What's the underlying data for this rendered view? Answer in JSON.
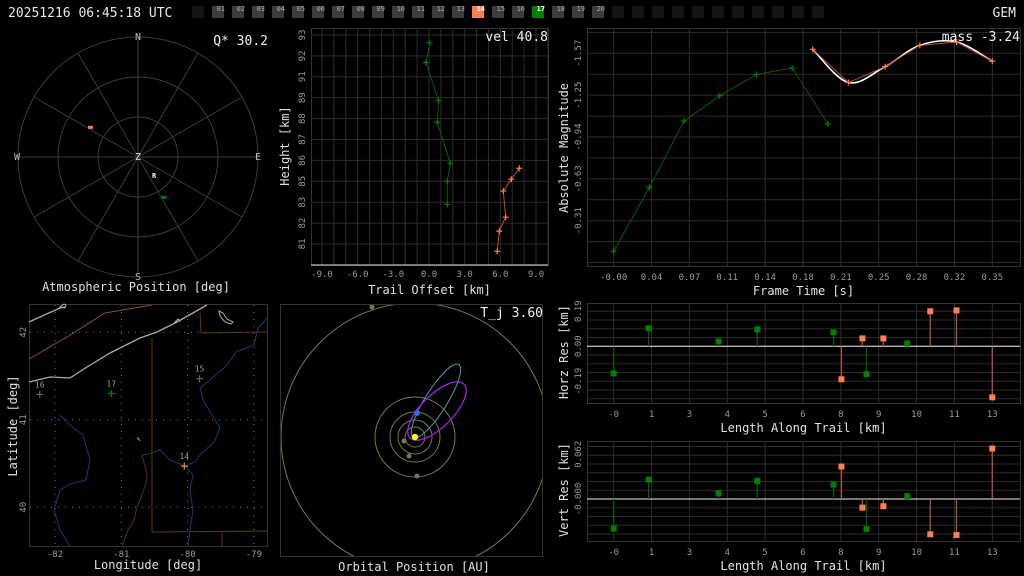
{
  "header": {
    "datetime": "20251216 06:45:18 UTC",
    "network": "GEM"
  },
  "colors": {
    "orange": "#ff7f50",
    "green": "#008000",
    "orange_line": "#b5532f",
    "green_line": "#0a5a0a",
    "inactive": "#3c3c3c",
    "empty": "#151515"
  },
  "camera_slots": [
    {
      "label": "01",
      "state": "inactive"
    },
    {
      "label": "02",
      "state": "inactive"
    },
    {
      "label": "03",
      "state": "inactive"
    },
    {
      "label": "04",
      "state": "inactive"
    },
    {
      "label": "05",
      "state": "inactive"
    },
    {
      "label": "06",
      "state": "inactive"
    },
    {
      "label": "07",
      "state": "inactive"
    },
    {
      "label": "08",
      "state": "inactive"
    },
    {
      "label": "09",
      "state": "inactive"
    },
    {
      "label": "10",
      "state": "inactive"
    },
    {
      "label": "11",
      "state": "inactive"
    },
    {
      "label": "12",
      "state": "inactive"
    },
    {
      "label": "13",
      "state": "inactive"
    },
    {
      "label": "14",
      "state": "orange"
    },
    {
      "label": "15",
      "state": "inactive"
    },
    {
      "label": "16",
      "state": "inactive"
    },
    {
      "label": "17",
      "state": "green"
    },
    {
      "label": "18",
      "state": "inactive"
    },
    {
      "label": "19",
      "state": "inactive"
    },
    {
      "label": "20",
      "state": "inactive"
    }
  ],
  "polar": {
    "title": "Atmospheric Position [deg]",
    "metric": "Q* 30.2",
    "directions": {
      "n": "N",
      "s": "S",
      "e": "E",
      "w": "W",
      "zenith": "Z"
    },
    "radiant_label": "R",
    "radiant": {
      "az": 138,
      "zen": 18
    },
    "points": [
      {
        "station": "14",
        "color": "orange",
        "az": 302,
        "zen": 42
      },
      {
        "station": "17",
        "color": "green",
        "az": 147,
        "zen": 36
      }
    ]
  },
  "chart_data": [
    {
      "id": "height",
      "type": "line",
      "title": "",
      "xlabel": "Trail Offset [km]",
      "ylabel": "Height [km]",
      "metric": "vel 40.8",
      "xticks": [
        "-9.0",
        "-6.0",
        "-3.0",
        "0.0",
        "3.0",
        "6.0",
        "9.0"
      ],
      "yticks": [
        "93",
        "92",
        "91",
        "89",
        "88",
        "87",
        "86",
        "85",
        "83",
        "82",
        "81"
      ],
      "xlim": [
        -9,
        9
      ],
      "ylim": [
        81,
        93
      ],
      "series": [
        {
          "name": "17",
          "color": "green",
          "x": [
            0.06,
            -0.25,
            0.81,
            0.7,
            1.79,
            1.54,
            1.54
          ],
          "y": [
            92.56,
            91.43,
            89.23,
            87.99,
            85.64,
            84.6,
            83.28
          ]
        },
        {
          "name": "14",
          "color": "orange",
          "x": [
            7.59,
            6.92,
            6.25,
            6.45,
            5.91,
            5.74
          ],
          "y": [
            85.35,
            84.72,
            84.04,
            82.54,
            81.74,
            80.58
          ]
        }
      ]
    },
    {
      "id": "magnitude",
      "type": "line",
      "xlabel": "Frame Time [s]",
      "ylabel": "Absolute Magnitude",
      "metric": "mass -3.24",
      "xticks": [
        "-0.00",
        "0.04",
        "0.07",
        "0.11",
        "0.14",
        "0.18",
        "0.21",
        "0.25",
        "0.28",
        "0.32",
        "0.35"
      ],
      "yticks": [
        "-1.57",
        "-1.25",
        "-0.94",
        "-0.63",
        "-0.31"
      ],
      "series": [
        {
          "name": "17",
          "color": "green",
          "x": [
            0.0,
            0.033,
            0.065,
            0.098,
            0.132,
            0.165,
            0.198
          ],
          "y": [
            -0.08,
            -0.56,
            -1.06,
            -1.25,
            -1.41,
            -1.46,
            -1.04
          ]
        },
        {
          "name": "14",
          "color": "orange",
          "x": [
            0.184,
            0.217,
            0.251,
            0.283,
            0.317,
            0.35
          ],
          "y": [
            -1.6,
            -1.35,
            -1.47,
            -1.63,
            -1.655,
            -1.51
          ],
          "fit": true
        }
      ]
    },
    {
      "id": "horz_res",
      "type": "scatter",
      "xlabel": "Length Along Trail [km]",
      "ylabel": "Horz Res [km]",
      "xticks": [
        "-0",
        "1",
        "3",
        "4",
        "5",
        "6",
        "8",
        "9",
        "10",
        "11",
        "13"
      ],
      "yticks": [
        "0.19",
        "0.00",
        "-0.19"
      ],
      "series": [
        {
          "name": "17",
          "color": "green",
          "x": [
            0,
            1.2,
            3.6,
            4.93,
            7.55,
            8.68,
            10.08
          ],
          "y": [
            -0.147,
            0.098,
            0.027,
            0.092,
            0.076,
            -0.152,
            0.016
          ]
        },
        {
          "name": "14",
          "color": "orange",
          "x": [
            7.82,
            8.54,
            9.26,
            10.87,
            11.77,
            13.0
          ],
          "y": [
            -0.179,
            0.043,
            0.043,
            0.19,
            0.195,
            -0.277
          ]
        }
      ]
    },
    {
      "id": "vert_res",
      "type": "scatter",
      "xlabel": "Length Along Trail [km]",
      "ylabel": "Vert Res [km]",
      "xticks": [
        "-0",
        "1",
        "3",
        "4",
        "5",
        "6",
        "8",
        "9",
        "10",
        "11",
        "13"
      ],
      "yticks": [
        "0.062",
        "-0.000"
      ],
      "series": [
        {
          "name": "17",
          "color": "green",
          "x": [
            0,
            1.2,
            3.6,
            4.93,
            7.55,
            8.68,
            10.08
          ],
          "y": [
            -0.041,
            0.027,
            0.008,
            0.025,
            0.02,
            -0.042,
            0.004
          ]
        },
        {
          "name": "14",
          "color": "orange",
          "x": [
            7.82,
            8.54,
            9.26,
            10.87,
            11.77,
            13.0
          ],
          "y": [
            0.045,
            -0.012,
            -0.01,
            -0.049,
            -0.05,
            0.07
          ]
        }
      ]
    }
  ],
  "map": {
    "xlabel": "Longitude [deg]",
    "ylabel": "Latitude [deg]",
    "xticks": [
      -82,
      -81,
      -80,
      -79
    ],
    "yticks": [
      42,
      41,
      40
    ],
    "stations": [
      {
        "label": "16",
        "lon": -82.23,
        "lat": 41.29,
        "state": "inactive"
      },
      {
        "label": "17",
        "lon": -81.15,
        "lat": 41.3,
        "state": "green"
      },
      {
        "label": "15",
        "lon": -79.82,
        "lat": 41.47,
        "state": "inactive"
      },
      {
        "label": "14",
        "lon": -80.05,
        "lat": 40.47,
        "state": "orange"
      }
    ],
    "trail": {
      "lon": -80.74,
      "lat": 40.78
    }
  },
  "orbit": {
    "title": "Orbital Position [AU]",
    "metric": "T_j 3.60"
  }
}
